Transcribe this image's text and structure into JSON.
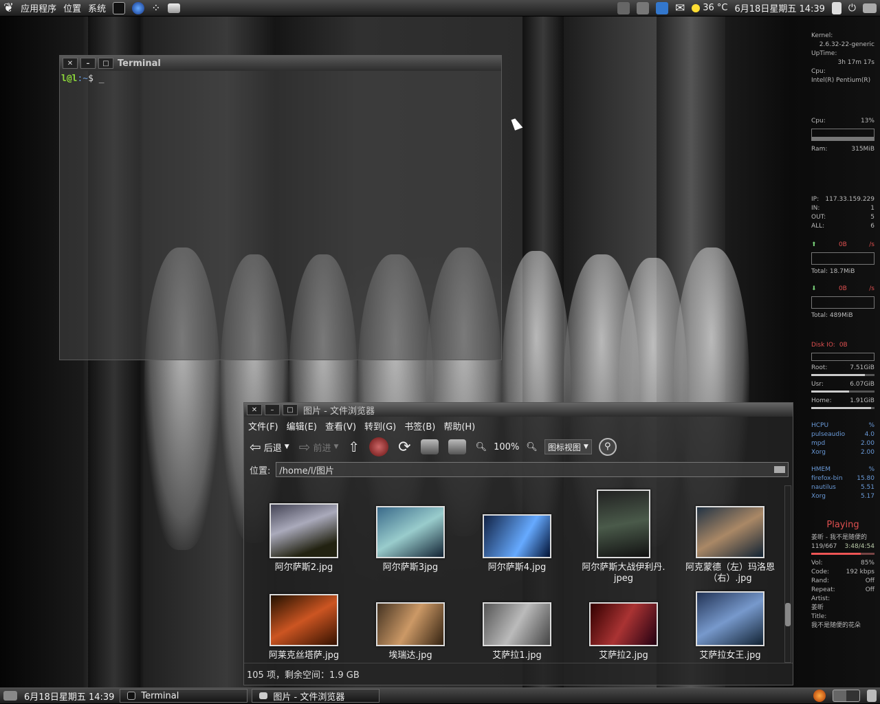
{
  "top_panel": {
    "menus": [
      "应用程序",
      "位置",
      "系统"
    ],
    "temperature": "36 °C",
    "clock": "6月18日星期五 14:39"
  },
  "terminal": {
    "title": "Terminal",
    "prompt_user": "l@l",
    "prompt_path": ":~",
    "prompt_symbol": "$",
    "cursor": "_"
  },
  "file_browser": {
    "title": "图片 - 文件浏览器",
    "menus": [
      "文件(F)",
      "编辑(E)",
      "查看(V)",
      "转到(G)",
      "书签(B)",
      "帮助(H)"
    ],
    "back_label": "后退",
    "forward_label": "前进",
    "zoom": "100%",
    "view_mode": "图标视图",
    "location_label": "位置:",
    "location_path": "/home/l/图片",
    "files": [
      {
        "name": "阿尔萨斯2.jpg"
      },
      {
        "name": "阿尔萨斯3jpg"
      },
      {
        "name": "阿尔萨斯4.jpg"
      },
      {
        "name": "阿尔萨斯大战伊利丹.\njpeg"
      },
      {
        "name": "阿克蒙德（左）玛洛恩\n（右）.jpg"
      },
      {
        "name": "阿莱克丝塔萨.jpg"
      },
      {
        "name": "埃瑞达.jpg"
      },
      {
        "name": "艾萨拉1.jpg"
      },
      {
        "name": "艾萨拉2.jpg"
      },
      {
        "name": "艾萨拉女王.jpg"
      }
    ],
    "status": "105 项，剩余空间：1.9 GB"
  },
  "conky": {
    "kernel_label": "Kernel:",
    "kernel": "2.6.32-22-generic",
    "uptime_label": "UpTime:",
    "uptime": "3h 17m 17s",
    "cpu_label": "Cpu:",
    "cpu_model": "Intel(R) Pentium(R)",
    "cpu_usage_label": "Cpu:",
    "cpu_usage": "13%",
    "ram_label": "Ram:",
    "ram": "315MiB",
    "ip_label": "IP:",
    "ip": "117.33.159.229",
    "in_label": "IN:",
    "in": "1",
    "out_label": "OUT:",
    "out": "5",
    "all_label": "ALL:",
    "all": "6",
    "up_rate": "0B",
    "rate_unit": "/s",
    "up_total": "Total: 18.7MiB",
    "down_rate": "0B",
    "down_total": "Total: 489MiB",
    "disk_io_label": "Disk IO:",
    "disk_io": "0B",
    "root_label": "Root:",
    "root": "7.51GiB",
    "root_fraction": 0.85,
    "usr_label": "Usr:",
    "usr": "6.07GiB",
    "usr_fraction": 0.6,
    "home_label": "Home:",
    "home": "1.91GiB",
    "home_fraction": 0.95,
    "hcpu_header": "HCPU",
    "percent": "%",
    "hcpu": [
      {
        "name": "pulseaudio",
        "value": "4.0"
      },
      {
        "name": "mpd",
        "value": "2.00"
      },
      {
        "name": "Xorg",
        "value": "2.00"
      }
    ],
    "hmem_header": "HMEM",
    "hmem": [
      {
        "name": "firefox-bin",
        "value": "15.80"
      },
      {
        "name": "nautilus",
        "value": "5.51"
      },
      {
        "name": "Xorg",
        "value": "5.17"
      }
    ],
    "playing_label": "Playing",
    "song_line": "姜昕 - 我不是随便的",
    "track": "119/667",
    "time": "3:48/4:54",
    "progress": 0.78,
    "vol_label": "Vol:",
    "vol": "85%",
    "codec_label": "Code:",
    "codec": "192 kbps",
    "rand_label": "Rand:",
    "rand": "Off",
    "repeat_label": "Repeat:",
    "repeat": "Off",
    "artist_label": "Artist:",
    "artist": "姜昕",
    "title_label": "Title:",
    "title": "我不是随便的花朵"
  },
  "bottom_panel": {
    "clock": "6月18日星期五 14:39",
    "tasks": [
      "Terminal",
      "图片 - 文件浏览器"
    ]
  }
}
